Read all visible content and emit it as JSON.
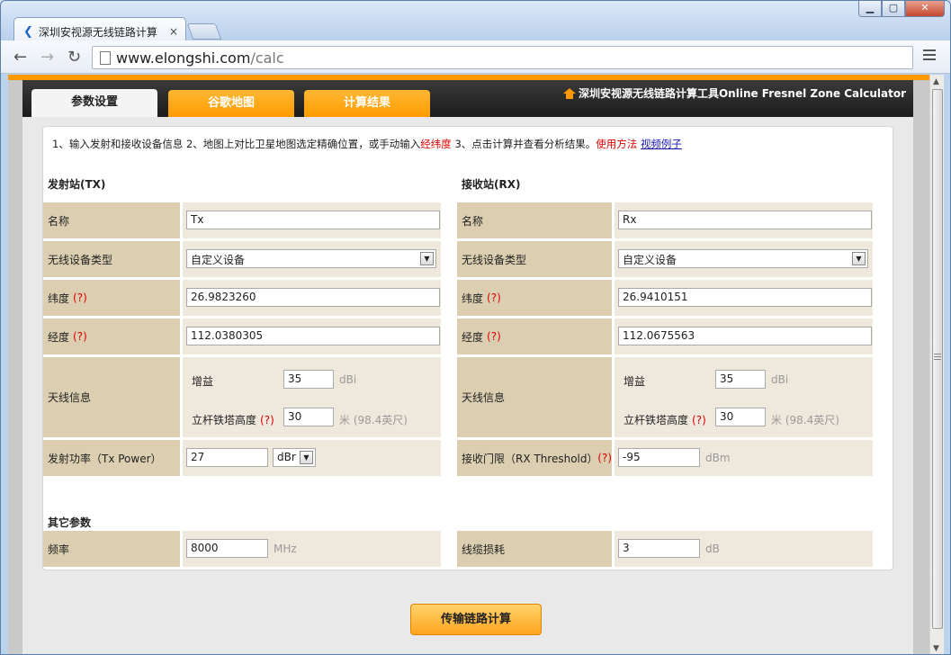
{
  "browser": {
    "tab_title": "深圳安视源无线链路计算",
    "tab_close": "×",
    "url_host": "www.elongshi.com",
    "url_path": "/calc",
    "window_min": "▁",
    "window_max": "▢",
    "window_close": "✕"
  },
  "header": {
    "tabs": [
      "参数设置",
      "谷歌地图",
      "计算结果"
    ],
    "site_title": "深圳安视源无线链路计算工具Online Fresnel Zone Calculator"
  },
  "instructions": {
    "part1": "1、输入发射和接收设备信息 2、地图上对比卫星地图选定精确位置，或手动输入",
    "red1": "经纬度",
    "part2": " 3、点击计算并查看分析结果。",
    "red2": "使用方法",
    "link": "视频例子"
  },
  "tx": {
    "heading": "发射站(TX)",
    "name_label": "名称",
    "name_value": "Tx",
    "device_label": "无线设备类型",
    "device_value": "自定义设备",
    "lat_label": "纬度",
    "lat_value": "26.9823260",
    "lon_label": "经度",
    "lon_value": "112.0380305",
    "antenna_label": "天线信息",
    "gain_label": "增益",
    "gain_value": "35",
    "gain_unit": "dBi",
    "height_label": "立杆铁塔高度",
    "height_value": "30",
    "height_unit": "米 (98.4英尺)",
    "power_label": "发射功率（Tx Power）",
    "power_value": "27",
    "power_unit": "dBr"
  },
  "rx": {
    "heading": "接收站(RX)",
    "name_label": "名称",
    "name_value": "Rx",
    "device_label": "无线设备类型",
    "device_value": "自定义设备",
    "lat_label": "纬度",
    "lat_value": "26.9410151",
    "lon_label": "经度",
    "lon_value": "112.0675563",
    "antenna_label": "天线信息",
    "gain_label": "增益",
    "gain_value": "35",
    "gain_unit": "dBi",
    "height_label": "立杆铁塔高度",
    "height_value": "30",
    "height_unit": "米 (98.4英尺)",
    "threshold_label": "接收门限（RX Threshold）",
    "threshold_value": "-95",
    "threshold_unit": "dBm"
  },
  "other": {
    "heading": "其它参数",
    "freq_label": "频率",
    "freq_value": "8000",
    "freq_unit": "MHz",
    "cable_label": "线缆损耗",
    "cable_value": "3",
    "cable_unit": "dB"
  },
  "help_mark": "(?)",
  "calc_button": "传输链路计算",
  "colors": {
    "accent": "#ff9900",
    "label_bg": "#dccfb1",
    "value_bg": "#efe9dd",
    "help_red": "#dd0000"
  }
}
